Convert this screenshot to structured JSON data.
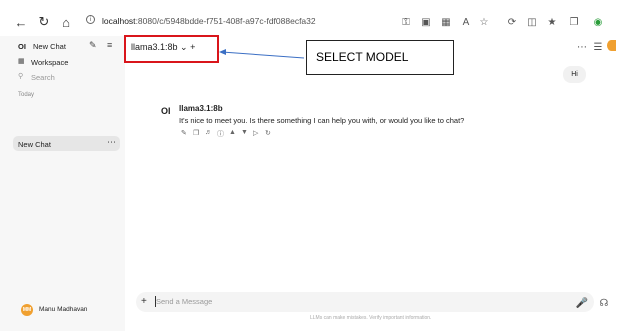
{
  "browser": {
    "url_host": "localhost",
    "url_rest": ":8080/c/5948bdde-f751-408f-a97c-fdf088ecfa32"
  },
  "sidebar": {
    "logo": "OI",
    "new_chat": "New Chat",
    "workspace": "Workspace",
    "search_placeholder": "Search",
    "section_today": "Today",
    "chat_items": [
      "New Chat"
    ],
    "user_initials": "MM",
    "user_name": "Manu Madhavan"
  },
  "header": {
    "model_name": "llama3.1:8b",
    "add_model": "+"
  },
  "annotation": {
    "label": "SELECT MODEL",
    "border_color": "#d9151b",
    "arrow_color": "#3b6fc4"
  },
  "conversation": {
    "user_message": "Hi",
    "assistant_logo": "OI",
    "assistant_model": "llama3.1:8b",
    "assistant_message": "It's nice to meet you. Is there something I can help you with, or would you like to chat?"
  },
  "composer": {
    "placeholder": "Send a Message",
    "disclaimer": "LLMs can make mistakes. Verify important information."
  },
  "icons": {
    "back": "arrow-left-icon",
    "reload": "reload-icon",
    "home": "home-icon",
    "info": "info-icon",
    "mic": "microphone-icon",
    "headphones": "headphones-icon"
  }
}
